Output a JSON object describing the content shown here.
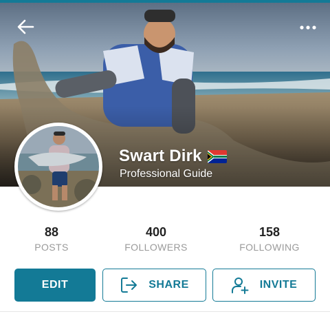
{
  "profile": {
    "name": "Swart Dirk",
    "role": "Professional Guide",
    "country_flag_icon": "south-africa-flag-icon"
  },
  "nav": {
    "back_icon": "back-arrow-icon",
    "more_icon": "more-dots-icon"
  },
  "stats": [
    {
      "value": "88",
      "label": "POSTS"
    },
    {
      "value": "400",
      "label": "FOLLOWERS"
    },
    {
      "value": "158",
      "label": "FOLLOWING"
    }
  ],
  "actions": {
    "edit_label": "EDIT",
    "share_label": "SHARE",
    "invite_label": "INVITE",
    "share_icon": "share-exit-icon",
    "invite_icon": "add-person-icon"
  },
  "colors": {
    "accent": "#137a96",
    "stat_label": "#9a9a9a"
  }
}
